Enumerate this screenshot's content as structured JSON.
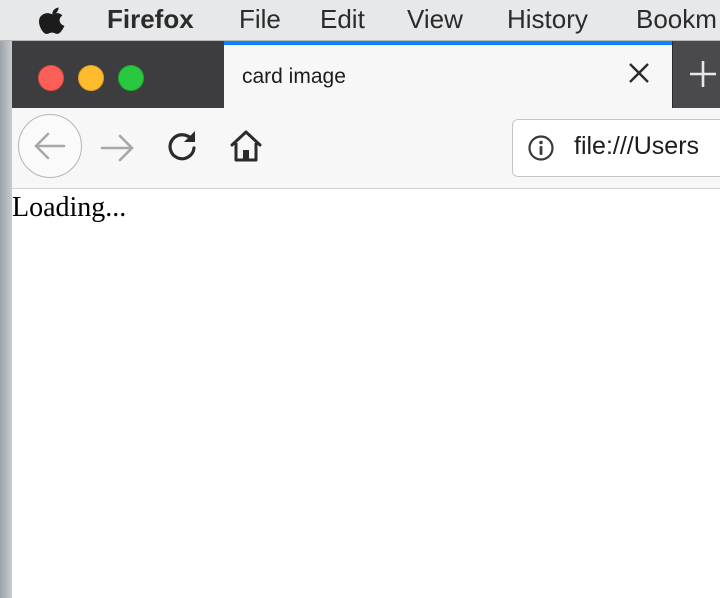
{
  "menubar": {
    "app_name": "Firefox",
    "items": [
      "File",
      "Edit",
      "View",
      "History",
      "Bookm"
    ]
  },
  "tab": {
    "title": "card image"
  },
  "urlbar": {
    "value": "file:///Users"
  },
  "page": {
    "text": "Loading..."
  },
  "colors": {
    "tab_accent": "#0a84ff",
    "tabbar_bg": "#3d3d3f",
    "close": "#fc5f57",
    "minimize": "#fdbc2e",
    "maximize": "#29c840"
  },
  "icons": {
    "apple": "apple-logo-icon",
    "back": "arrow-left-icon",
    "forward": "arrow-right-icon",
    "reload": "reload-icon",
    "home": "home-icon",
    "info": "info-icon",
    "tab_close": "close-icon",
    "new_tab": "plus-icon"
  }
}
